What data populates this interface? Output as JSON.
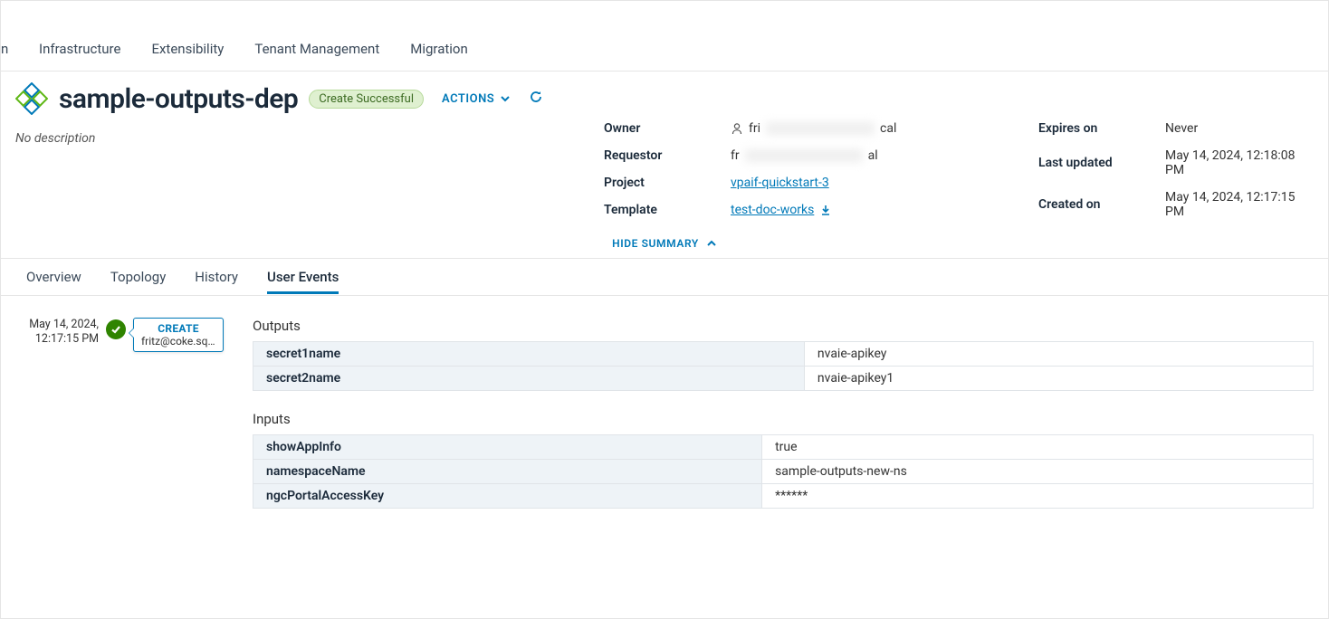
{
  "nav": {
    "cut_label": "n",
    "items": [
      "Infrastructure",
      "Extensibility",
      "Tenant Management",
      "Migration"
    ]
  },
  "header": {
    "title": "sample-outputs-dep",
    "status": "Create Successful",
    "actions_label": "ACTIONS",
    "description": "No description"
  },
  "summary": {
    "owner_label": "Owner",
    "owner_value_prefix": "fri",
    "owner_value_suffix": "cal",
    "requestor_label": "Requestor",
    "requestor_value_prefix": "fr",
    "requestor_value_suffix": "al",
    "project_label": "Project",
    "project_value": "vpaif-quickstart-3",
    "template_label": "Template",
    "template_value": "test-doc-works",
    "expires_label": "Expires on",
    "expires_value": "Never",
    "updated_label": "Last updated",
    "updated_value": "May 14, 2024, 12:18:08 PM",
    "created_label": "Created on",
    "created_value": "May 14, 2024, 12:17:15 PM",
    "hide_label": "HIDE SUMMARY"
  },
  "tabs": {
    "items": [
      "Overview",
      "Topology",
      "History",
      "User Events"
    ],
    "active_index": 3
  },
  "event": {
    "timestamp_line1": "May 14, 2024,",
    "timestamp_line2": "12:17:15 PM",
    "action": "CREATE",
    "user": "fritz@coke.sqa-…"
  },
  "outputs": {
    "title": "Outputs",
    "rows": [
      {
        "key": "secret1name",
        "value": "nvaie-apikey"
      },
      {
        "key": "secret2name",
        "value": "nvaie-apikey1"
      }
    ]
  },
  "inputs": {
    "title": "Inputs",
    "rows": [
      {
        "key": "showAppInfo",
        "value": "true"
      },
      {
        "key": "namespaceName",
        "value": "sample-outputs-new-ns"
      },
      {
        "key": "ngcPortalAccessKey",
        "value": "******"
      }
    ]
  }
}
